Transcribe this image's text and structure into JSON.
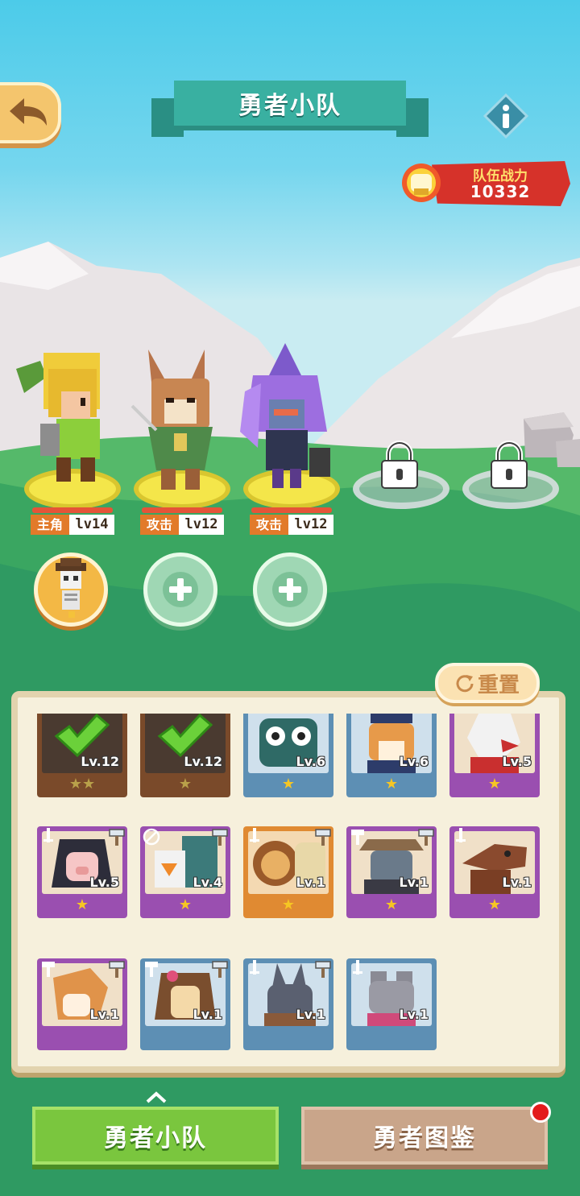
{
  "header": {
    "title": "勇者小队",
    "back_icon": "back-arrow-icon",
    "info_icon": "info-icon"
  },
  "team_power": {
    "label": "队伍战力",
    "value": "10332"
  },
  "heroes": [
    {
      "role": "主角",
      "level": "lv14",
      "locked": false
    },
    {
      "role": "攻击",
      "level": "lv12",
      "locked": false
    },
    {
      "role": "攻击",
      "level": "lv12",
      "locked": false
    },
    {
      "locked": true
    },
    {
      "locked": true
    }
  ],
  "pet_slots": [
    {
      "state": "filled",
      "icon": "skeleton-pet-icon"
    },
    {
      "state": "empty",
      "icon": "paw-plus-icon"
    },
    {
      "state": "empty",
      "icon": "paw-plus-icon"
    }
  ],
  "reset_button": {
    "label": "重置",
    "icon": "refresh-icon"
  },
  "roster": [
    {
      "level": "Lv.12",
      "stars": "★★",
      "color": "brown",
      "selected": true
    },
    {
      "level": "Lv.12",
      "stars": "★",
      "color": "brown",
      "selected": true
    },
    {
      "level": "Lv.6",
      "stars": "★",
      "color": "blue",
      "selected": false
    },
    {
      "level": "Lv.6",
      "stars": "★",
      "color": "blue",
      "selected": false
    },
    {
      "level": "Lv.5",
      "stars": "★",
      "color": "purple",
      "selected": false
    },
    {
      "level": "Lv.5",
      "stars": "★",
      "color": "purple",
      "selected": false
    },
    {
      "level": "Lv.4",
      "stars": "★",
      "color": "purple",
      "selected": false
    },
    {
      "level": "Lv.1",
      "stars": "★",
      "color": "orange",
      "selected": false
    },
    {
      "level": "Lv.1",
      "stars": "★",
      "color": "purple",
      "selected": false
    },
    {
      "level": "Lv.1",
      "stars": "★",
      "color": "purple",
      "selected": false
    },
    {
      "level": "Lv.1",
      "stars": "",
      "color": "purple",
      "selected": false
    },
    {
      "level": "Lv.1",
      "stars": "",
      "color": "blue",
      "selected": false
    },
    {
      "level": "Lv.1",
      "stars": "",
      "color": "blue",
      "selected": false
    },
    {
      "level": "Lv.1",
      "stars": "",
      "color": "blue",
      "selected": false
    }
  ],
  "tabs": [
    {
      "label": "勇者小队",
      "active": true
    },
    {
      "label": "勇者图鉴",
      "active": false,
      "badge": true
    }
  ],
  "colors": {
    "sky": "#4ccbe9",
    "grass": "#2f9a62",
    "panel": "#f6f0dc",
    "active_tab": "#7ac63e",
    "inactive_tab": "#c9a58a",
    "power_banner": "#d6322a"
  }
}
